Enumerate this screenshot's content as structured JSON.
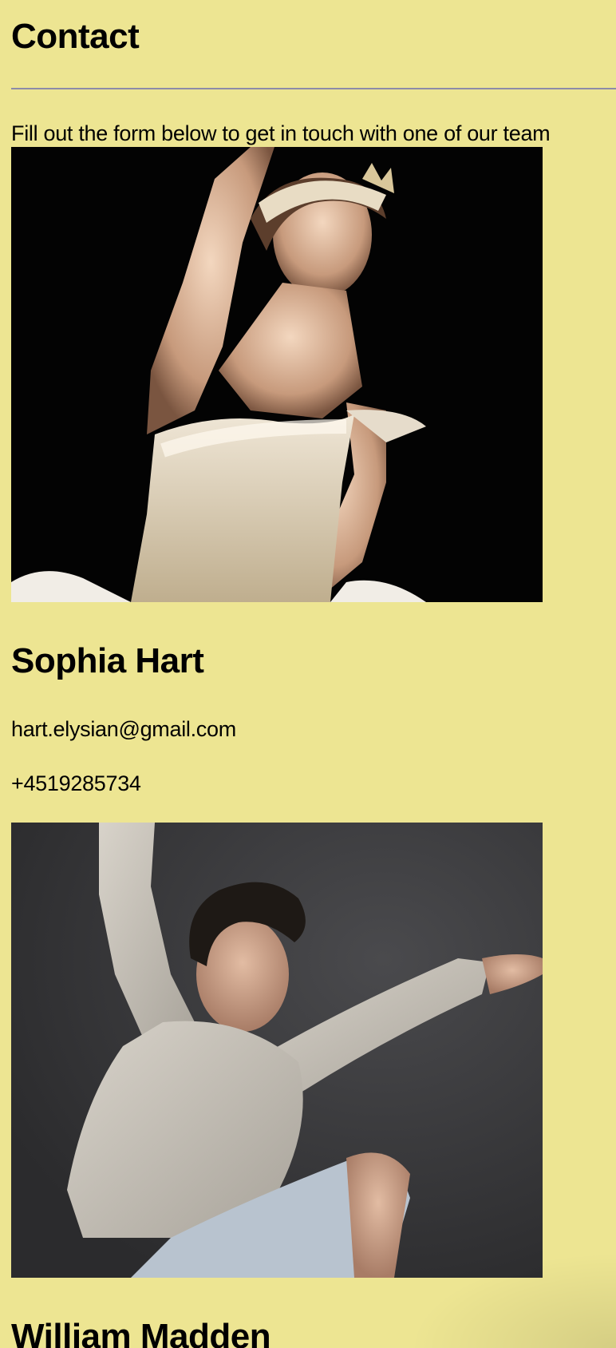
{
  "page": {
    "title": "Contact",
    "intro": "Fill out the form below to get in touch with one of our team"
  },
  "team": [
    {
      "name": "Sophia Hart",
      "email": "hart.elysian@gmail.com",
      "phone": "+4519285734",
      "photo_description": "ballerina-photo"
    },
    {
      "name": "William Madden",
      "photo_description": "male-dancer-photo"
    }
  ],
  "colors": {
    "background": "#ede592",
    "divider": "#8c8ca8",
    "text": "#000000"
  }
}
